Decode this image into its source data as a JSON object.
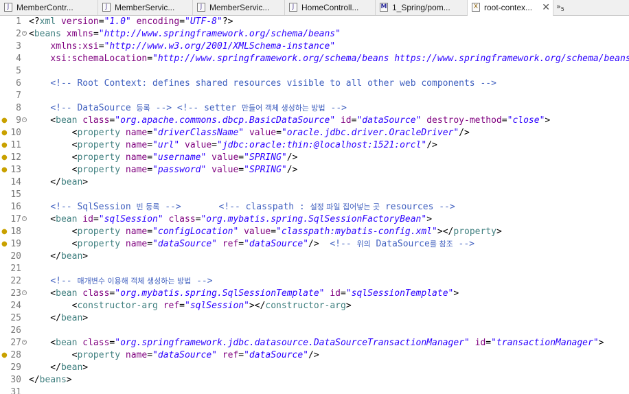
{
  "tabs": [
    {
      "label": "MemberContr...",
      "icon": "J",
      "icon_name": "java-file-icon"
    },
    {
      "label": "MemberServic...",
      "icon": "J",
      "icon_name": "java-file-icon"
    },
    {
      "label": "MemberServic...",
      "icon": "J",
      "icon_name": "java-file-icon"
    },
    {
      "label": "HomeControll...",
      "icon": "J",
      "icon_name": "java-file-icon"
    },
    {
      "label": "1_Spring/pom...",
      "icon": "M",
      "icon_name": "maven-pom-icon"
    },
    {
      "label": "root-contex...",
      "icon": "X",
      "icon_name": "xml-file-icon",
      "active": true
    }
  ],
  "tab_close": "✕",
  "tab_overflow": {
    "symbol": "»",
    "count": "5"
  },
  "colors": {
    "tag": "#3f7f7f",
    "attribute": "#7f007f",
    "value": "#2a00ff",
    "comment": "#3f5fbf",
    "line_number": "#787878",
    "marker": "#c9a100"
  },
  "editor": {
    "lines": [
      {
        "n": "1",
        "tokens": [
          {
            "t": "punct",
            "s": "<?"
          },
          {
            "t": "tag",
            "s": "xml"
          },
          {
            "t": "punct",
            "s": " "
          },
          {
            "t": "attr",
            "s": "version"
          },
          {
            "t": "punct",
            "s": "="
          },
          {
            "t": "val",
            "s": "\"1.0\""
          },
          {
            "t": "punct",
            "s": " "
          },
          {
            "t": "attr",
            "s": "encoding"
          },
          {
            "t": "punct",
            "s": "="
          },
          {
            "t": "val",
            "s": "\"UTF-8\""
          },
          {
            "t": "punct",
            "s": "?>"
          }
        ]
      },
      {
        "n": "2",
        "fold": true,
        "tokens": [
          {
            "t": "punct",
            "s": "<"
          },
          {
            "t": "tag",
            "s": "beans"
          },
          {
            "t": "punct",
            "s": " "
          },
          {
            "t": "attr",
            "s": "xmlns"
          },
          {
            "t": "punct",
            "s": "="
          },
          {
            "t": "val",
            "s": "\"http://www.springframework.org/schema/beans\""
          }
        ]
      },
      {
        "n": "3",
        "tokens": [
          {
            "t": "punct",
            "s": "    "
          },
          {
            "t": "attr",
            "s": "xmlns:xsi"
          },
          {
            "t": "punct",
            "s": "="
          },
          {
            "t": "val",
            "s": "\"http://www.w3.org/2001/XMLSchema-instance\""
          }
        ]
      },
      {
        "n": "4",
        "tokens": [
          {
            "t": "punct",
            "s": "    "
          },
          {
            "t": "attr",
            "s": "xsi:schemaLocation"
          },
          {
            "t": "punct",
            "s": "="
          },
          {
            "t": "val",
            "s": "\"http://www.springframework.org/schema/beans https://www.springframework.org/schema/beans"
          }
        ]
      },
      {
        "n": "5",
        "tokens": []
      },
      {
        "n": "6",
        "tokens": [
          {
            "t": "punct",
            "s": "    "
          },
          {
            "t": "com",
            "s": "<!-- Root Context: defines shared resources visible to all other web components -->"
          }
        ]
      },
      {
        "n": "7",
        "tokens": []
      },
      {
        "n": "8",
        "tokens": [
          {
            "t": "punct",
            "s": "    "
          },
          {
            "t": "com",
            "s": "<!-- DataSource "
          },
          {
            "t": "comkr",
            "s": "등록"
          },
          {
            "t": "com",
            "s": " --> <!-- setter "
          },
          {
            "t": "comkr",
            "s": "만들어 객체 생성하는 방법"
          },
          {
            "t": "com",
            "s": " -->"
          }
        ]
      },
      {
        "n": "9",
        "marker": true,
        "fold": true,
        "tokens": [
          {
            "t": "punct",
            "s": "    <"
          },
          {
            "t": "tag",
            "s": "bean"
          },
          {
            "t": "punct",
            "s": " "
          },
          {
            "t": "attr",
            "s": "class"
          },
          {
            "t": "punct",
            "s": "="
          },
          {
            "t": "val",
            "s": "\"org.apache.commons.dbcp.BasicDataSource\""
          },
          {
            "t": "punct",
            "s": " "
          },
          {
            "t": "attr",
            "s": "id"
          },
          {
            "t": "punct",
            "s": "="
          },
          {
            "t": "val",
            "s": "\"dataSource\""
          },
          {
            "t": "punct",
            "s": " "
          },
          {
            "t": "attr",
            "s": "destroy-method"
          },
          {
            "t": "punct",
            "s": "="
          },
          {
            "t": "val",
            "s": "\"close\""
          },
          {
            "t": "punct",
            "s": ">"
          }
        ]
      },
      {
        "n": "10",
        "marker": true,
        "tokens": [
          {
            "t": "punct",
            "s": "        <"
          },
          {
            "t": "tag",
            "s": "property"
          },
          {
            "t": "punct",
            "s": " "
          },
          {
            "t": "attr",
            "s": "name"
          },
          {
            "t": "punct",
            "s": "="
          },
          {
            "t": "val",
            "s": "\"driverClassName\""
          },
          {
            "t": "punct",
            "s": " "
          },
          {
            "t": "attr",
            "s": "value"
          },
          {
            "t": "punct",
            "s": "="
          },
          {
            "t": "val",
            "s": "\"oracle.jdbc.driver.OracleDriver\""
          },
          {
            "t": "punct",
            "s": "/>"
          }
        ]
      },
      {
        "n": "11",
        "marker": true,
        "tokens": [
          {
            "t": "punct",
            "s": "        <"
          },
          {
            "t": "tag",
            "s": "property"
          },
          {
            "t": "punct",
            "s": " "
          },
          {
            "t": "attr",
            "s": "name"
          },
          {
            "t": "punct",
            "s": "="
          },
          {
            "t": "val",
            "s": "\"url\""
          },
          {
            "t": "punct",
            "s": " "
          },
          {
            "t": "attr",
            "s": "value"
          },
          {
            "t": "punct",
            "s": "="
          },
          {
            "t": "val",
            "s": "\"jdbc:oracle:thin:@localhost:1521:orcl\""
          },
          {
            "t": "punct",
            "s": "/>"
          }
        ]
      },
      {
        "n": "12",
        "marker": true,
        "tokens": [
          {
            "t": "punct",
            "s": "        <"
          },
          {
            "t": "tag",
            "s": "property"
          },
          {
            "t": "punct",
            "s": " "
          },
          {
            "t": "attr",
            "s": "name"
          },
          {
            "t": "punct",
            "s": "="
          },
          {
            "t": "val",
            "s": "\"username\""
          },
          {
            "t": "punct",
            "s": " "
          },
          {
            "t": "attr",
            "s": "value"
          },
          {
            "t": "punct",
            "s": "="
          },
          {
            "t": "val",
            "s": "\"SPRING\""
          },
          {
            "t": "punct",
            "s": "/>"
          }
        ]
      },
      {
        "n": "13",
        "marker": true,
        "tokens": [
          {
            "t": "punct",
            "s": "        <"
          },
          {
            "t": "tag",
            "s": "property"
          },
          {
            "t": "punct",
            "s": " "
          },
          {
            "t": "attr",
            "s": "name"
          },
          {
            "t": "punct",
            "s": "="
          },
          {
            "t": "val",
            "s": "\"password\""
          },
          {
            "t": "punct",
            "s": " "
          },
          {
            "t": "attr",
            "s": "value"
          },
          {
            "t": "punct",
            "s": "="
          },
          {
            "t": "val",
            "s": "\"SPRING\""
          },
          {
            "t": "punct",
            "s": "/>"
          }
        ]
      },
      {
        "n": "14",
        "tokens": [
          {
            "t": "punct",
            "s": "    </"
          },
          {
            "t": "tag",
            "s": "bean"
          },
          {
            "t": "punct",
            "s": ">"
          }
        ]
      },
      {
        "n": "15",
        "tokens": []
      },
      {
        "n": "16",
        "tokens": [
          {
            "t": "punct",
            "s": "    "
          },
          {
            "t": "com",
            "s": "<!-- SqlSession "
          },
          {
            "t": "comkr",
            "s": "빈 등록"
          },
          {
            "t": "com",
            "s": " -->       <!-- classpath : "
          },
          {
            "t": "comkr",
            "s": "설정 파일 집어넣는 곳"
          },
          {
            "t": "com",
            "s": " resources -->"
          }
        ]
      },
      {
        "n": "17",
        "fold": true,
        "tokens": [
          {
            "t": "punct",
            "s": "    <"
          },
          {
            "t": "tag",
            "s": "bean"
          },
          {
            "t": "punct",
            "s": " "
          },
          {
            "t": "attr",
            "s": "id"
          },
          {
            "t": "punct",
            "s": "="
          },
          {
            "t": "val",
            "s": "\"sqlSession\""
          },
          {
            "t": "punct",
            "s": " "
          },
          {
            "t": "attr",
            "s": "class"
          },
          {
            "t": "punct",
            "s": "="
          },
          {
            "t": "val",
            "s": "\"org.mybatis.spring.SqlSessionFactoryBean\""
          },
          {
            "t": "punct",
            "s": ">"
          }
        ]
      },
      {
        "n": "18",
        "marker": true,
        "tokens": [
          {
            "t": "punct",
            "s": "        <"
          },
          {
            "t": "tag",
            "s": "property"
          },
          {
            "t": "punct",
            "s": " "
          },
          {
            "t": "attr",
            "s": "name"
          },
          {
            "t": "punct",
            "s": "="
          },
          {
            "t": "val",
            "s": "\"configLocation\""
          },
          {
            "t": "punct",
            "s": " "
          },
          {
            "t": "attr",
            "s": "value"
          },
          {
            "t": "punct",
            "s": "="
          },
          {
            "t": "val",
            "s": "\"classpath:mybatis-config.xml\""
          },
          {
            "t": "punct",
            "s": "></"
          },
          {
            "t": "tag",
            "s": "property"
          },
          {
            "t": "punct",
            "s": ">"
          }
        ]
      },
      {
        "n": "19",
        "marker": true,
        "tokens": [
          {
            "t": "punct",
            "s": "        <"
          },
          {
            "t": "tag",
            "s": "property"
          },
          {
            "t": "punct",
            "s": " "
          },
          {
            "t": "attr",
            "s": "name"
          },
          {
            "t": "punct",
            "s": "="
          },
          {
            "t": "val",
            "s": "\"dataSource\""
          },
          {
            "t": "punct",
            "s": " "
          },
          {
            "t": "attr",
            "s": "ref"
          },
          {
            "t": "punct",
            "s": "="
          },
          {
            "t": "val",
            "s": "\"dataSource\""
          },
          {
            "t": "punct",
            "s": "/>  "
          },
          {
            "t": "com",
            "s": "<!-- "
          },
          {
            "t": "comkr",
            "s": "위의"
          },
          {
            "t": "com",
            "s": " DataSource"
          },
          {
            "t": "comkr",
            "s": "를 참조"
          },
          {
            "t": "com",
            "s": " -->"
          }
        ]
      },
      {
        "n": "20",
        "tokens": [
          {
            "t": "punct",
            "s": "    </"
          },
          {
            "t": "tag",
            "s": "bean"
          },
          {
            "t": "punct",
            "s": ">"
          }
        ]
      },
      {
        "n": "21",
        "tokens": []
      },
      {
        "n": "22",
        "tokens": [
          {
            "t": "punct",
            "s": "    "
          },
          {
            "t": "com",
            "s": "<!-- "
          },
          {
            "t": "comkr",
            "s": "매개변수 이용해 객체 생성하는 방법"
          },
          {
            "t": "com",
            "s": " -->"
          }
        ]
      },
      {
        "n": "23",
        "fold": true,
        "tokens": [
          {
            "t": "punct",
            "s": "    <"
          },
          {
            "t": "tag",
            "s": "bean"
          },
          {
            "t": "punct",
            "s": " "
          },
          {
            "t": "attr",
            "s": "class"
          },
          {
            "t": "punct",
            "s": "="
          },
          {
            "t": "val",
            "s": "\"org.mybatis.spring.SqlSessionTemplate\""
          },
          {
            "t": "punct",
            "s": " "
          },
          {
            "t": "attr",
            "s": "id"
          },
          {
            "t": "punct",
            "s": "="
          },
          {
            "t": "val",
            "s": "\"sqlSessionTemplate\""
          },
          {
            "t": "punct",
            "s": ">"
          }
        ]
      },
      {
        "n": "24",
        "tokens": [
          {
            "t": "punct",
            "s": "        <"
          },
          {
            "t": "tag",
            "s": "constructor-arg"
          },
          {
            "t": "punct",
            "s": " "
          },
          {
            "t": "attr",
            "s": "ref"
          },
          {
            "t": "punct",
            "s": "="
          },
          {
            "t": "val",
            "s": "\"sqlSession\""
          },
          {
            "t": "punct",
            "s": "></"
          },
          {
            "t": "tag",
            "s": "constructor-arg"
          },
          {
            "t": "punct",
            "s": ">"
          }
        ]
      },
      {
        "n": "25",
        "tokens": [
          {
            "t": "punct",
            "s": "    </"
          },
          {
            "t": "tag",
            "s": "bean"
          },
          {
            "t": "punct",
            "s": ">"
          }
        ]
      },
      {
        "n": "26",
        "tokens": []
      },
      {
        "n": "27",
        "fold": true,
        "tokens": [
          {
            "t": "punct",
            "s": "    <"
          },
          {
            "t": "tag",
            "s": "bean"
          },
          {
            "t": "punct",
            "s": " "
          },
          {
            "t": "attr",
            "s": "class"
          },
          {
            "t": "punct",
            "s": "="
          },
          {
            "t": "val",
            "s": "\"org.springframework.jdbc.datasource.DataSourceTransactionManager\""
          },
          {
            "t": "punct",
            "s": " "
          },
          {
            "t": "attr",
            "s": "id"
          },
          {
            "t": "punct",
            "s": "="
          },
          {
            "t": "val",
            "s": "\"transactionManager\""
          },
          {
            "t": "punct",
            "s": ">"
          }
        ]
      },
      {
        "n": "28",
        "marker": true,
        "tokens": [
          {
            "t": "punct",
            "s": "        <"
          },
          {
            "t": "tag",
            "s": "property"
          },
          {
            "t": "punct",
            "s": " "
          },
          {
            "t": "attr",
            "s": "name"
          },
          {
            "t": "punct",
            "s": "="
          },
          {
            "t": "val",
            "s": "\"dataSource\""
          },
          {
            "t": "punct",
            "s": " "
          },
          {
            "t": "attr",
            "s": "ref"
          },
          {
            "t": "punct",
            "s": "="
          },
          {
            "t": "val",
            "s": "\"dataSource\""
          },
          {
            "t": "punct",
            "s": "/>"
          }
        ]
      },
      {
        "n": "29",
        "tokens": [
          {
            "t": "punct",
            "s": "    </"
          },
          {
            "t": "tag",
            "s": "bean"
          },
          {
            "t": "punct",
            "s": ">"
          }
        ]
      },
      {
        "n": "30",
        "tokens": [
          {
            "t": "punct",
            "s": "</"
          },
          {
            "t": "tag",
            "s": "beans"
          },
          {
            "t": "punct",
            "s": ">"
          }
        ]
      },
      {
        "n": "31",
        "tokens": []
      }
    ]
  }
}
